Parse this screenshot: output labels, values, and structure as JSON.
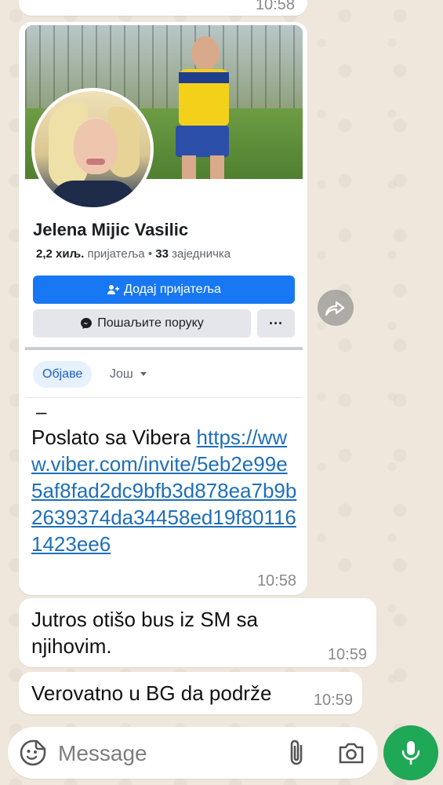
{
  "messages": {
    "top_time": "10:58",
    "shared_card": {
      "name": "Jelena Mijic Vasilic",
      "friends_count": "2,2 хиљ.",
      "friends_label": "пријатеља",
      "separator": "•",
      "mutual_count": "33",
      "mutual_label": "заједничка",
      "add_friend_label": "Додај пријатеља",
      "send_message_label": "Пошаљите поруку",
      "more_label": "···",
      "tab_posts": "Објаве",
      "tab_more": "Још"
    },
    "main_dash": "–",
    "main_text": "Poslato sa Vibera ",
    "main_link": "https://www.viber.com/invite/5eb2e99e5af8fad2dc9bfb3d878ea7b9b2639374da34458ed19f801161423ee6",
    "main_time": "10:58",
    "msg2_text": "Jutros otišo bus iz SM sa njihovim.",
    "msg2_time": "10:59",
    "msg3_text": "Verovatno u BG da podrže",
    "msg3_time": "10:59"
  },
  "input": {
    "placeholder": "Message"
  },
  "icons": {
    "emoji": "sticker-emoji-icon",
    "attach": "paperclip-icon",
    "camera": "camera-icon",
    "mic": "microphone-icon",
    "forward": "forward-share-icon"
  },
  "colors": {
    "fb_blue": "#1877f2",
    "wa_green": "#1fa855",
    "link": "#1f6fb8"
  }
}
